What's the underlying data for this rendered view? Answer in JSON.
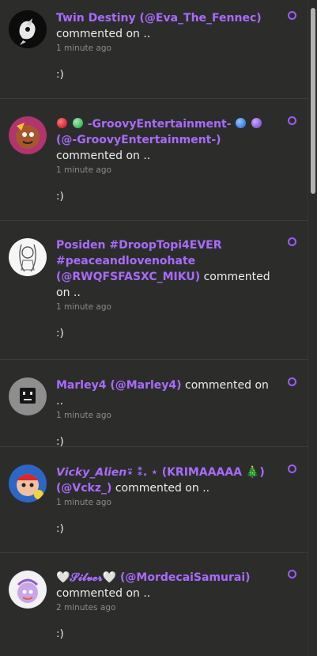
{
  "notifications": [
    {
      "name": "Twin Destiny (@Eva_The_Fennec)",
      "action": "commented on ..",
      "time": "1 minute ago",
      "body": ":)"
    },
    {
      "name_prefix": "-GroovyEntertainment-",
      "name_suffix": "(@-GroovyEntertainment-)",
      "action": "commented on ..",
      "time": "1 minute ago",
      "body": ":)"
    },
    {
      "name": "Posiden #DroopTopi4EVER #peaceandlovenohate (@RWQFSFASXC_MIKU)",
      "action": "commented on ..",
      "time": "1 minute ago",
      "body": ":)"
    },
    {
      "name": "Marley4 (@Marley4)",
      "action": "commented on ..",
      "time": "1 minute ago",
      "body": ":)"
    },
    {
      "name": "𝙑𝙞𝙘𝙠𝙮_𝘼𝙡𝙞𝙚𝙣⍣ ⁑. ⋆ (KRIMAAAAA 🎄) (@Vckz_)",
      "action": "commented on ..",
      "time": "1 minute ago",
      "body": ":)"
    },
    {
      "name": "🤍𝓢𝓲𝓵𝓿𝓮𝓻🤍 (@MordecaiSamurai)",
      "action": "commented on ..",
      "time": "2 minutes ago",
      "body": ":)"
    }
  ],
  "colors": {
    "username": "#a86bff",
    "unread_ring": "#9c5cff",
    "background": "#2c2d2a"
  },
  "icons": {
    "unread": "unread-circle-icon"
  }
}
